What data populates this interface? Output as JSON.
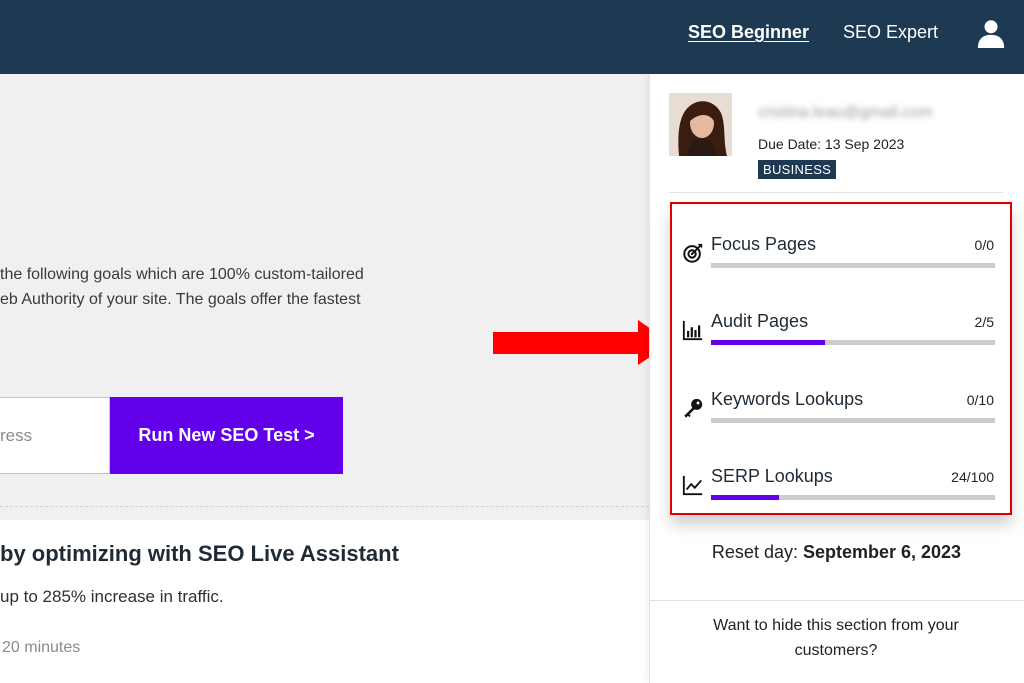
{
  "nav": {
    "items": [
      {
        "label": "SEO Beginner",
        "active": true
      },
      {
        "label": "SEO Expert",
        "active": false
      }
    ],
    "user_icon": "user-icon"
  },
  "main": {
    "description_lines": [
      " the following goals which are 100% custom-tailored",
      "eb Authority of your site. The goals offer the fastest"
    ],
    "url_input_placeholder": "ress",
    "run_button_label": "Run New SEO Test >",
    "card": {
      "title": "by optimizing with SEO Live Assistant",
      "subtitle": "up to 285% increase in traffic.",
      "time": "20 minutes"
    }
  },
  "panel": {
    "email": "cristina.leau@gmail.com",
    "due_date": "Due Date: 13 Sep 2023",
    "plan_badge": "BUSINESS",
    "usage": [
      {
        "label": "Focus Pages",
        "used": 0,
        "limit": 0,
        "count": "0/0",
        "icon": "target-icon"
      },
      {
        "label": "Audit Pages",
        "used": 2,
        "limit": 5,
        "count": "2/5",
        "icon": "bar-chart-icon"
      },
      {
        "label": "Keywords Lookups",
        "used": 0,
        "limit": 10,
        "count": "0/10",
        "icon": "key-icon"
      },
      {
        "label": "SERP Lookups",
        "used": 24,
        "limit": 100,
        "count": "24/100",
        "icon": "line-chart-icon"
      }
    ],
    "reset_label": "Reset day: ",
    "reset_date": "September 6, 2023",
    "hide_section_text": "Want to hide this section from your customers?"
  },
  "colors": {
    "header_bg": "#1e3a52",
    "accent": "#6200ea",
    "highlight_border": "#e10000",
    "arrow": "#ff0000"
  }
}
